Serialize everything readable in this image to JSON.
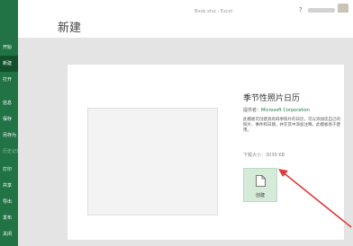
{
  "app": {
    "window_title": "Book.xlsx - Excel",
    "accent_color": "#217346"
  },
  "sidebar": {
    "items": [
      {
        "label": "开始"
      },
      {
        "label": "新建"
      },
      {
        "label": "打开"
      },
      {
        "label": "信息"
      },
      {
        "label": "保存"
      },
      {
        "label": "另存为"
      },
      {
        "label": "历史记录"
      },
      {
        "label": "打印"
      },
      {
        "label": "共享"
      },
      {
        "label": "导出"
      },
      {
        "label": "发布"
      },
      {
        "label": "关闭"
      }
    ]
  },
  "main": {
    "title": "新建"
  },
  "template": {
    "title": "季节性照片日历",
    "provider_label": "提供者：",
    "provider_name": "Microsoft Corporation",
    "description": "此模板可创建具有四季照片的日历，可以添加您自己的照片、事件和日期，并在其中添加注释。此模板易于使用。",
    "download_size": "下载大小：3039 KB",
    "create_label": "创建"
  }
}
